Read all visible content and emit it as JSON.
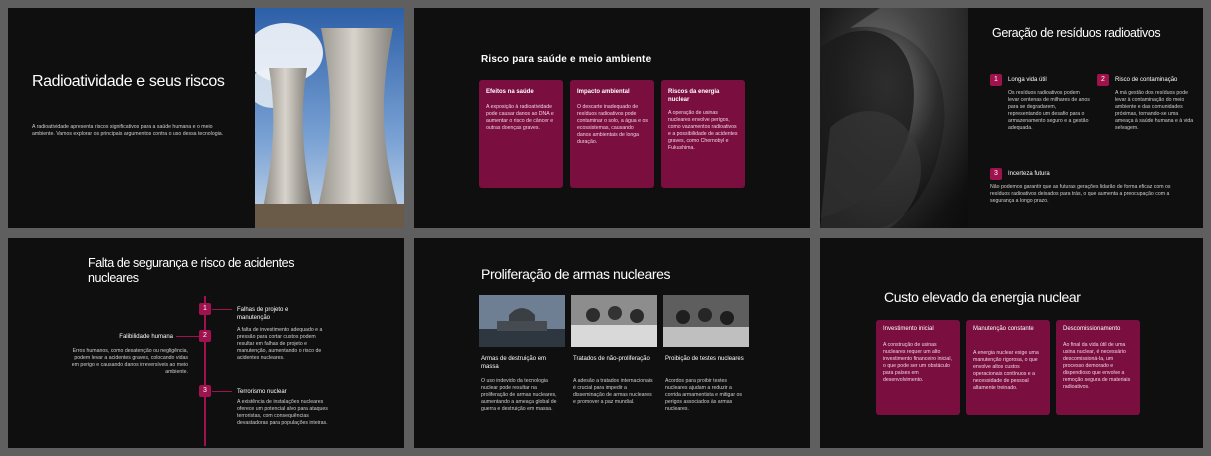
{
  "slide1": {
    "title": "Radioatividade e seus riscos",
    "body": "A radioatividade apresenta riscos significativos para a saúde humana e o meio ambiente. Vamos explorar os principais argumentos contra o uso dessa tecnologia."
  },
  "slide2": {
    "title": "Risco para saúde e meio ambiente",
    "cards": [
      {
        "title": "Efeitos na saúde",
        "text": "A exposição à radioatividade pode causar danos ao DNA e aumentar o risco de câncer e outras doenças graves."
      },
      {
        "title": "Impacto ambiental",
        "text": "O descarte inadequado de resíduos radioativos pode contaminar o solo, a água e os ecossistemas, causando danos ambientais de longa duração."
      },
      {
        "title": "Riscos da energia nuclear",
        "text": "A operação de usinas nucleares envolve perigos, como vazamentos radioativos e a possibilidade de acidentes graves, como Chernobyl e Fukushima."
      }
    ]
  },
  "slide3": {
    "title": "Geração de resíduos radioativos",
    "items": [
      {
        "num": "1",
        "title": "Longa vida útil",
        "text": "Os resíduos radioativos podem levar centenas de milhares de anos para se degradarem, representando um desafio para o armazenamento seguro e a gestão adequada."
      },
      {
        "num": "2",
        "title": "Risco de contaminação",
        "text": "A má gestão dos resíduos pode levar à contaminação do meio ambiente e das comunidades próximas, tornando-se uma ameaça à saúde humana e à vida selvagem."
      },
      {
        "num": "3",
        "title": "Incerteza futura",
        "text": "Não podemos garantir que as futuras gerações lidarão de forma eficaz com os resíduos radioativos deixados para trás, o que aumenta a preocupação com a segurança a longo prazo."
      }
    ]
  },
  "slide4": {
    "title": "Falta de segurança e risco de acidentes nucleares",
    "items": [
      {
        "num": "1",
        "title": "Falhas de projeto e manutenção",
        "text": "A falta de investimento adequado e a pressão para cortar custos podem resultar em falhas de projeto e manutenção, aumentando o risco de acidentes nucleares."
      },
      {
        "num": "2",
        "title": "Falibilidade humana",
        "text": "Erros humanos, como desatenção ou negligência, podem levar a acidentes graves, colocando vidas em perigo e causando danos irreversíveis ao meio ambiente."
      },
      {
        "num": "3",
        "title": "Terrorismo nuclear",
        "text": "A existência de instalações nucleares oferece um potencial alvo para ataques terroristas, com consequências devastadoras para populações inteiras."
      }
    ]
  },
  "slide5": {
    "title": "Proliferação de armas nucleares",
    "cols": [
      {
        "title": "Armas de destruição em massa",
        "text": "O uso indevido da tecnologia nuclear pode resultar na proliferação de armas nucleares, aumentando a ameaça global de guerra e destruição em massa."
      },
      {
        "title": "Tratados de não-proliferação",
        "text": "A adesão a tratados internacionais é crucial para impedir a disseminação de armas nucleares e promover a paz mundial."
      },
      {
        "title": "Proibição de testes nucleares",
        "text": "Acordos para proibir testes nucleares ajudam a reduzir a corrida armamentista e mitigar os perigos associados às armas nucleares."
      }
    ]
  },
  "slide6": {
    "title": "Custo elevado da energia nuclear",
    "cards": [
      {
        "title": "Investimento inicial",
        "text": "A construção de usinas nucleares requer um alto investimento financeiro inicial, o que pode ser um obstáculo para países em desenvolvimento."
      },
      {
        "title": "Manutenção constante",
        "text": "A energia nuclear exige uma manutenção rigorosa, o que envolve altos custos operacionais contínuos e a necessidade de pessoal altamente treinado."
      },
      {
        "title": "Descomissionamento",
        "text": "Ao final da vida útil de uma usina nuclear, é necessário descomissioná-la, um processo demorado e dispendioso que envolve a remoção segura de materiais radioativos."
      }
    ]
  },
  "colors": {
    "accent": "#a0124e",
    "card": "#7a0f3f",
    "background": "#0f0f10"
  }
}
